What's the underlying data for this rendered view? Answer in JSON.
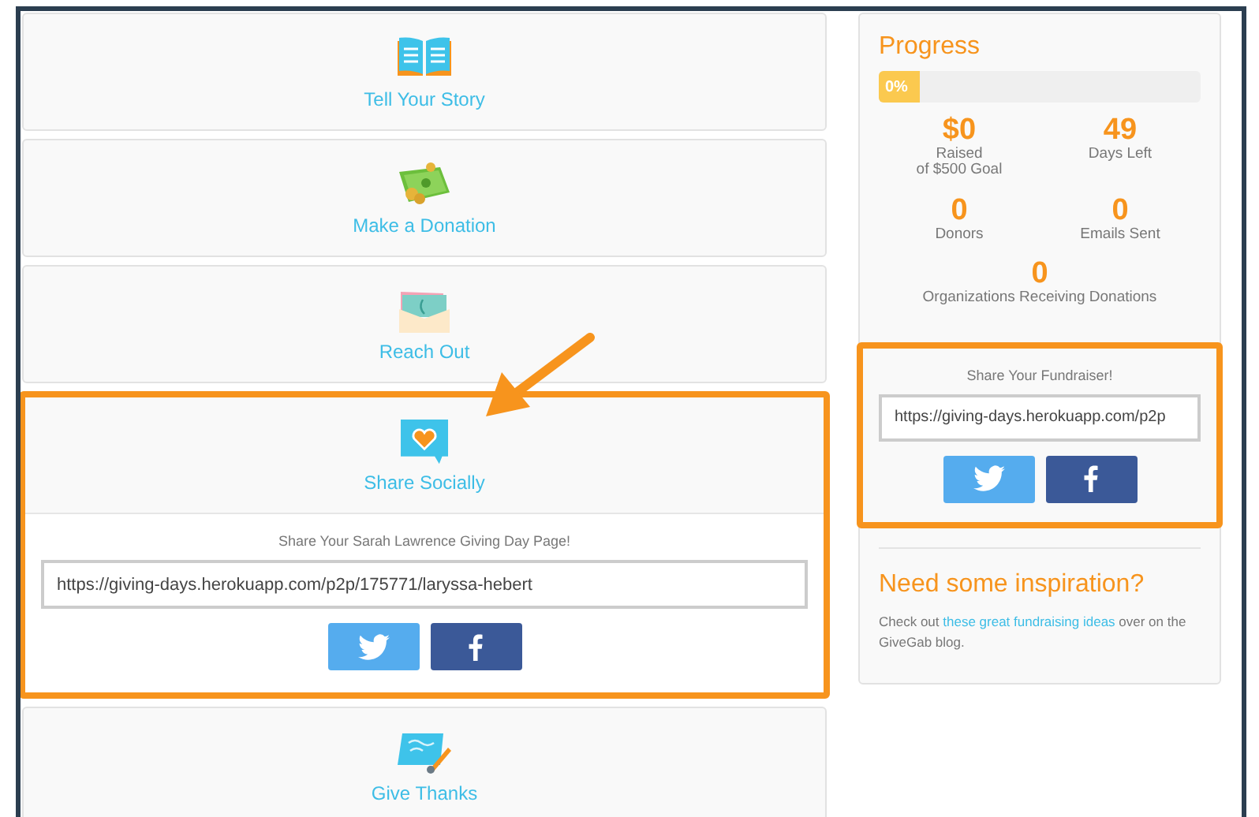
{
  "steps": [
    {
      "label": "Tell Your Story",
      "kind": "book",
      "highlighted": false
    },
    {
      "label": "Make a Donation",
      "kind": "money",
      "highlighted": false
    },
    {
      "label": "Reach Out",
      "kind": "envelope",
      "highlighted": false
    },
    {
      "label": "Share Socially",
      "kind": "chat-heart",
      "highlighted": true,
      "share": {
        "prompt": "Share Your Sarah Lawrence Giving Day Page!",
        "url": "https://giving-days.herokuapp.com/p2p/175771/laryssa-hebert"
      }
    },
    {
      "label": "Give Thanks",
      "kind": "card",
      "highlighted": false
    }
  ],
  "callout": {
    "kind": "arrow"
  },
  "progress": {
    "title": "Progress",
    "level": 0,
    "percent": "0%",
    "stats": [
      {
        "value": "$0",
        "label": "Raised\nof $500 Goal"
      },
      {
        "value": "49",
        "label": "Days Left"
      },
      {
        "value": "0",
        "label": "Donors"
      },
      {
        "value": "0",
        "label": "Emails Sent"
      },
      {
        "value": "0",
        "label": "Organizations Receiving Donations"
      }
    ]
  },
  "sidebar_share": {
    "prompt": "Share Your Fundraiser!",
    "url": "https://giving-days.herokuapp.com/p2p",
    "highlighted": true
  },
  "inspiration": {
    "title": "Need some inspiration?",
    "text_before": "Check out ",
    "link": "these great fundraising ideas",
    "text_after": " over on the GiveGab blog."
  }
}
